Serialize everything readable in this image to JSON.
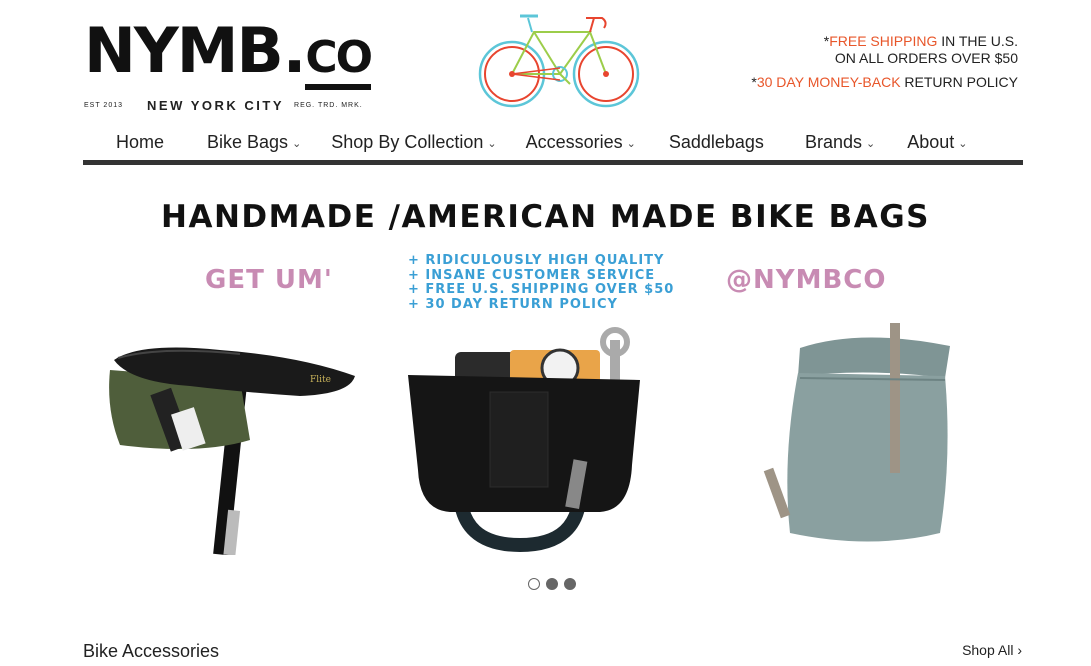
{
  "logo": {
    "main": "NYMB",
    "dot": ".",
    "co": "CO",
    "est": "EST 2013",
    "city": "NEW YORK CITY",
    "reg": "REG. TRD. MRK."
  },
  "promo": {
    "line1_prefix": "*",
    "line1_highlight": "FREE SHIPPING",
    "line1_rest": " IN THE U.S.",
    "line2": "ON ALL ORDERS OVER $50",
    "line3_prefix": "*",
    "line3_highlight": "30 DAY MONEY-BACK",
    "line3_rest": " RETURN POLICY",
    "highlight_color": "#e8562a"
  },
  "nav": {
    "items": [
      {
        "label": "Home",
        "dropdown": false
      },
      {
        "label": "Bike Bags",
        "dropdown": true
      },
      {
        "label": "Shop By Collection",
        "dropdown": true
      },
      {
        "label": "Accessories",
        "dropdown": true
      },
      {
        "label": "Saddlebags",
        "dropdown": false
      },
      {
        "label": "Brands",
        "dropdown": true
      },
      {
        "label": "About",
        "dropdown": true
      }
    ]
  },
  "hero": {
    "title": "HANDMADE /AMERICAN MADE BIKE BAGS",
    "left_tag": "GET UM'",
    "right_tag": "@NYMBCO",
    "features": [
      "+ RIDICULOUSLY HIGH QUALITY",
      "+ INSANE CUSTOMER SERVICE",
      "+ FREE U.S. SHIPPING OVER $50",
      "+ 30 DAY RETURN POLICY"
    ],
    "accent_pink": "#c88bb3",
    "accent_blue": "#3a9fd5",
    "slides": 3,
    "active_slide": 1
  },
  "section": {
    "title": "Bike Accessories",
    "shop_all": "Shop All ›"
  }
}
